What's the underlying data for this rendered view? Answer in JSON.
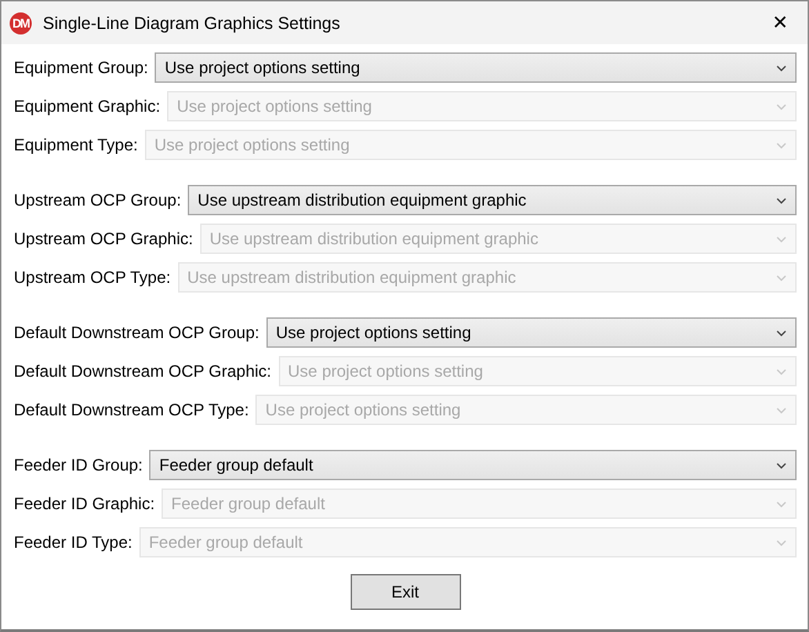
{
  "window": {
    "title": "Single-Line Diagram Graphics Settings",
    "logo": "DM",
    "close": "✕"
  },
  "groups": [
    {
      "rows": [
        {
          "label": "Equipment Group:",
          "value": "Use project options setting",
          "disabled": false
        },
        {
          "label": "Equipment Graphic:",
          "value": "Use project options setting",
          "disabled": true
        },
        {
          "label": "Equipment Type:",
          "value": "Use project options setting",
          "disabled": true
        }
      ]
    },
    {
      "rows": [
        {
          "label": "Upstream OCP Group:",
          "value": "Use upstream distribution equipment graphic",
          "disabled": false
        },
        {
          "label": "Upstream OCP Graphic:",
          "value": "Use upstream distribution equipment graphic",
          "disabled": true
        },
        {
          "label": "Upstream OCP Type:",
          "value": "Use upstream distribution equipment graphic",
          "disabled": true
        }
      ]
    },
    {
      "rows": [
        {
          "label": "Default Downstream OCP Group:",
          "value": "Use project options setting",
          "disabled": false
        },
        {
          "label": "Default Downstream OCP Graphic:",
          "value": "Use project options setting",
          "disabled": true
        },
        {
          "label": "Default Downstream OCP Type:",
          "value": "Use project options setting",
          "disabled": true
        }
      ]
    },
    {
      "rows": [
        {
          "label": "Feeder ID Group:",
          "value": "Feeder group default",
          "disabled": false
        },
        {
          "label": "Feeder ID Graphic:",
          "value": "Feeder group default",
          "disabled": true
        },
        {
          "label": "Feeder ID Type:",
          "value": "Feeder group default",
          "disabled": true
        }
      ]
    }
  ],
  "buttons": [
    "Exit"
  ]
}
